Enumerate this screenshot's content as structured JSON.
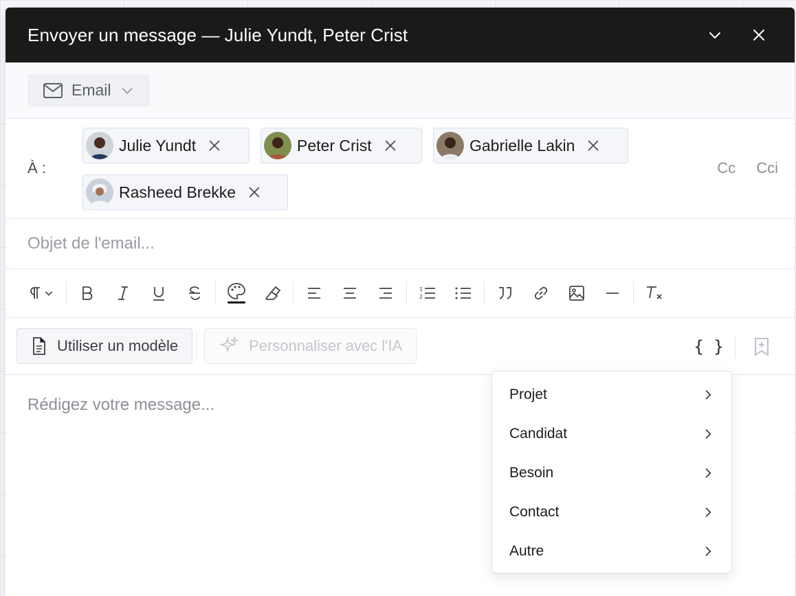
{
  "header": {
    "title": "Envoyer un message — Julie Yundt, Peter Crist"
  },
  "channel": {
    "label": "Email"
  },
  "recipients": {
    "to_label": "À :",
    "list": [
      {
        "name": "Julie Yundt"
      },
      {
        "name": "Peter Crist"
      },
      {
        "name": "Gabrielle Lakin"
      },
      {
        "name": "Rasheed Brekke"
      }
    ],
    "cc_label": "Cc",
    "bcc_label": "Cci"
  },
  "subject": {
    "placeholder": "Objet de l'email...",
    "value": ""
  },
  "actions": {
    "template_label": "Utiliser un modèle",
    "ai_label": "Personnaliser avec l'IA",
    "variables_label": "{ }"
  },
  "body": {
    "placeholder": "Rédigez votre message..."
  },
  "variables_menu": {
    "items": [
      {
        "label": "Projet"
      },
      {
        "label": "Candidat"
      },
      {
        "label": "Besoin"
      },
      {
        "label": "Contact"
      },
      {
        "label": "Autre"
      }
    ]
  },
  "colors": {
    "header_bg": "#1b1a19",
    "chip_border": "#dadeee",
    "text_color_indicator": "#111111"
  }
}
